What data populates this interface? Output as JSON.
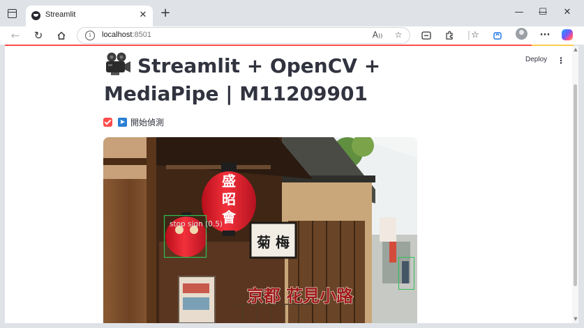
{
  "browser": {
    "tab_title": "Streamlit",
    "tab_close": "✕",
    "new_tab": "+",
    "window_controls": {
      "minimize": "—",
      "maximize": "☐",
      "close": "✕"
    },
    "url_host": "localhost",
    "url_port": ":8501",
    "icons": [
      "back-icon",
      "refresh-icon",
      "home-icon",
      "info-icon",
      "read-aloud-icon",
      "favorite-star-icon",
      "extension-icon",
      "favorites-icon",
      "collections-icon",
      "profile-icon",
      "more-icon",
      "copilot-icon"
    ]
  },
  "streamlit": {
    "deploy_label": "Deploy",
    "menu_label": "⋮",
    "title": "Streamlit + OpenCV + MediaPipe | M11209901",
    "title_icon": "movie-camera-icon",
    "checkbox": {
      "checked": true,
      "icon": "play-button-icon",
      "label": "開始偵測"
    },
    "accent_color": "#ff4b4b"
  },
  "video_frame": {
    "detections": [
      {
        "label": "stop sign",
        "score": "(0.5)"
      }
    ],
    "scene_text": {
      "lantern_top": "盛",
      "lantern_mid": "昭",
      "lantern_bottom": "會",
      "shop_sign": "菊 梅",
      "caption": "京都 花見小路"
    }
  }
}
